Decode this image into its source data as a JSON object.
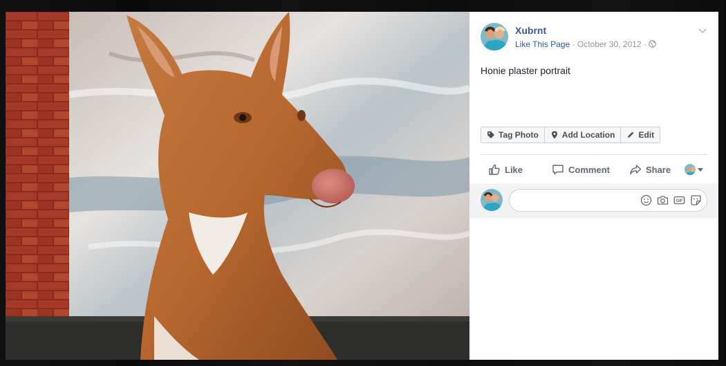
{
  "post": {
    "author": "Xubrnt",
    "like_page": "Like This Page",
    "separator": "·",
    "date": "October 30, 2012",
    "privacy_icon": "globe-icon",
    "caption": "Honie plaster portrait"
  },
  "photo_tools": {
    "tag_photo": "Tag Photo",
    "add_location": "Add Location",
    "edit": "Edit"
  },
  "actions": {
    "like": "Like",
    "comment": "Comment",
    "share": "Share"
  },
  "comment_box": {
    "placeholder": ""
  },
  "icons": {
    "chevron": "chevron-down-icon",
    "tag": "tag-icon",
    "location": "location-pin-icon",
    "edit": "pencil-icon",
    "like": "thumbs-up-icon",
    "comment": "speech-bubble-icon",
    "share": "share-arrow-icon",
    "emoji": "smiley-icon",
    "camera": "camera-icon",
    "gif": "gif-icon",
    "sticker": "sticker-icon"
  },
  "colors": {
    "link": "#365899",
    "muted": "#90949c",
    "text": "#1d2129",
    "action_text": "#606770"
  }
}
